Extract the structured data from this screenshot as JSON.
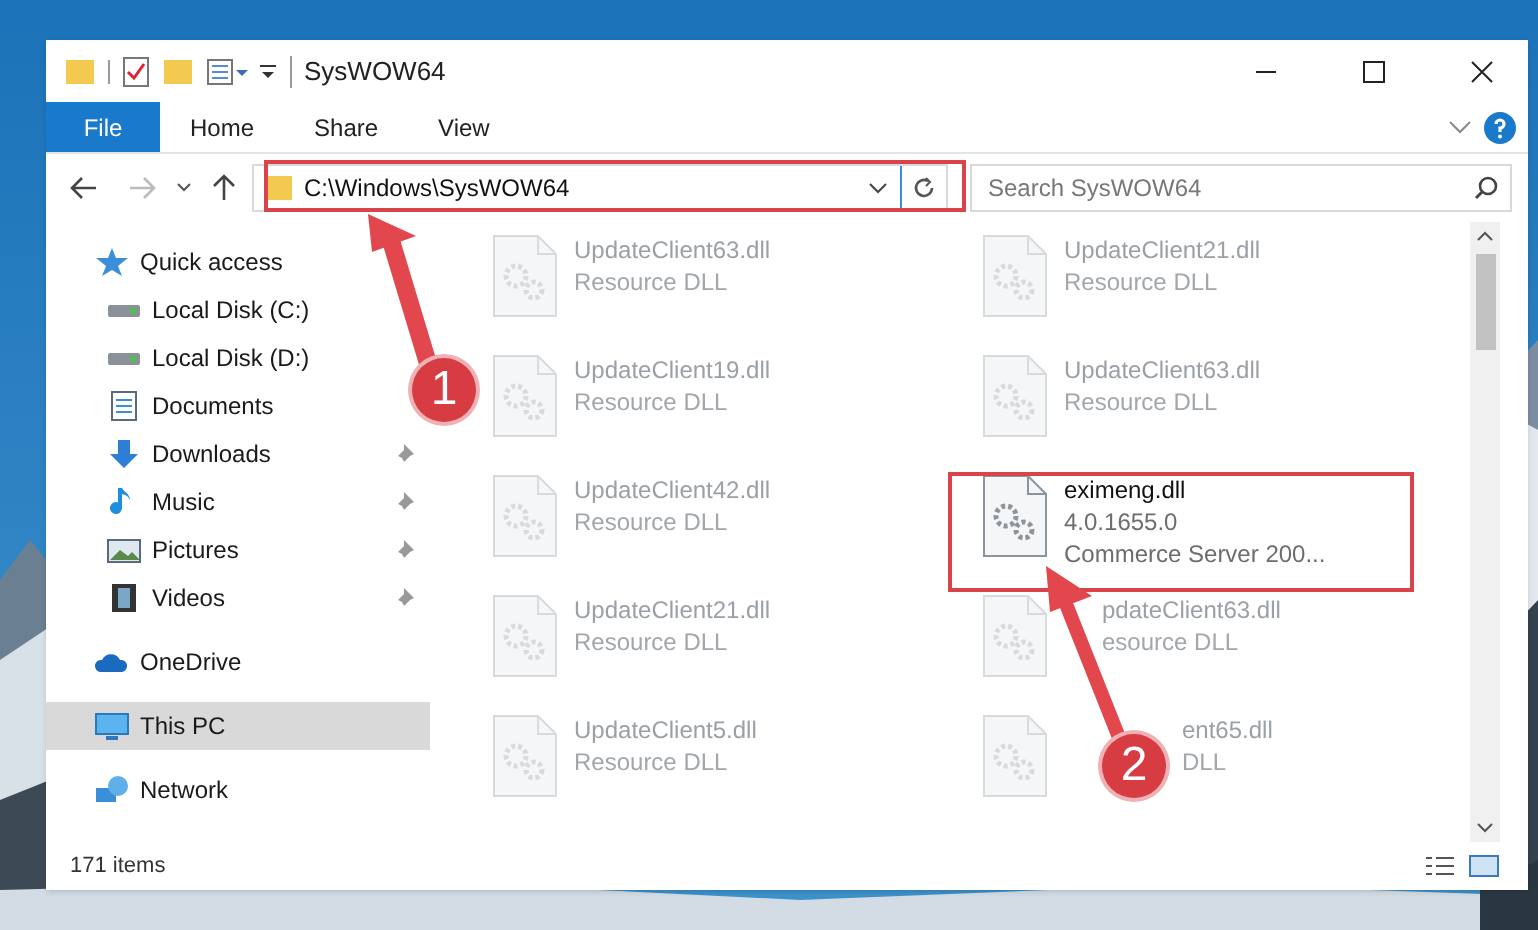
{
  "window": {
    "title": "SysWOW64"
  },
  "ribbon_tabs": [
    {
      "label": "File",
      "selected": true
    },
    {
      "label": "Home",
      "selected": false
    },
    {
      "label": "Share",
      "selected": false
    },
    {
      "label": "View",
      "selected": false
    }
  ],
  "address_bar": {
    "value": "C:\\Windows\\SysWOW64"
  },
  "search": {
    "placeholder": "Search SysWOW64"
  },
  "sidebar": {
    "items": [
      {
        "label": "Quick access",
        "kind": "star",
        "selected": false,
        "pinned": false,
        "children": [
          {
            "label": "Local Disk (C:)",
            "kind": "disk",
            "selected": false,
            "pinned": false
          },
          {
            "label": "Local Disk (D:)",
            "kind": "disk",
            "selected": false,
            "pinned": false
          },
          {
            "label": "Documents",
            "kind": "documents",
            "selected": false,
            "pinned": false
          },
          {
            "label": "Downloads",
            "kind": "downloads",
            "selected": false,
            "pinned": true
          },
          {
            "label": "Music",
            "kind": "music",
            "selected": false,
            "pinned": true
          },
          {
            "label": "Pictures",
            "kind": "pictures",
            "selected": false,
            "pinned": true
          },
          {
            "label": "Videos",
            "kind": "videos",
            "selected": false,
            "pinned": true
          }
        ]
      },
      {
        "label": "OneDrive",
        "kind": "cloud",
        "selected": false,
        "pinned": false
      },
      {
        "label": "This PC",
        "kind": "pc",
        "selected": true,
        "pinned": false
      },
      {
        "label": "Network",
        "kind": "network",
        "selected": false,
        "pinned": false
      }
    ]
  },
  "files": [
    {
      "name": "UpdateClient63.dll",
      "details": [
        "Resource DLL"
      ],
      "faded": true
    },
    {
      "name": "UpdateClient21.dll",
      "details": [
        "Resource DLL"
      ],
      "faded": true
    },
    {
      "name": "UpdateClient19.dll",
      "details": [
        "Resource DLL"
      ],
      "faded": true
    },
    {
      "name": "UpdateClient63.dll",
      "details": [
        "Resource DLL"
      ],
      "faded": true
    },
    {
      "name": "UpdateClient42.dll",
      "details": [
        "Resource DLL"
      ],
      "faded": true
    },
    {
      "name": "eximeng.dll",
      "details": [
        "4.0.1655.0",
        "Commerce Server 200..."
      ],
      "faded": false
    },
    {
      "name": "UpdateClient21.dll",
      "details": [
        "Resource DLL"
      ],
      "faded": true
    },
    {
      "name": "pdateClient63.dll",
      "details": [
        "esource DLL"
      ],
      "faded": true,
      "under_arrow": true
    },
    {
      "name": "UpdateClient5.dll",
      "details": [
        "Resource DLL"
      ],
      "faded": true
    },
    {
      "name": "ent65.dll",
      "details": [
        "DLL"
      ],
      "faded": true,
      "under_badge": true
    }
  ],
  "status_bar": {
    "item_count": "171 items"
  },
  "callouts": [
    {
      "number": "1"
    },
    {
      "number": "2"
    }
  ]
}
